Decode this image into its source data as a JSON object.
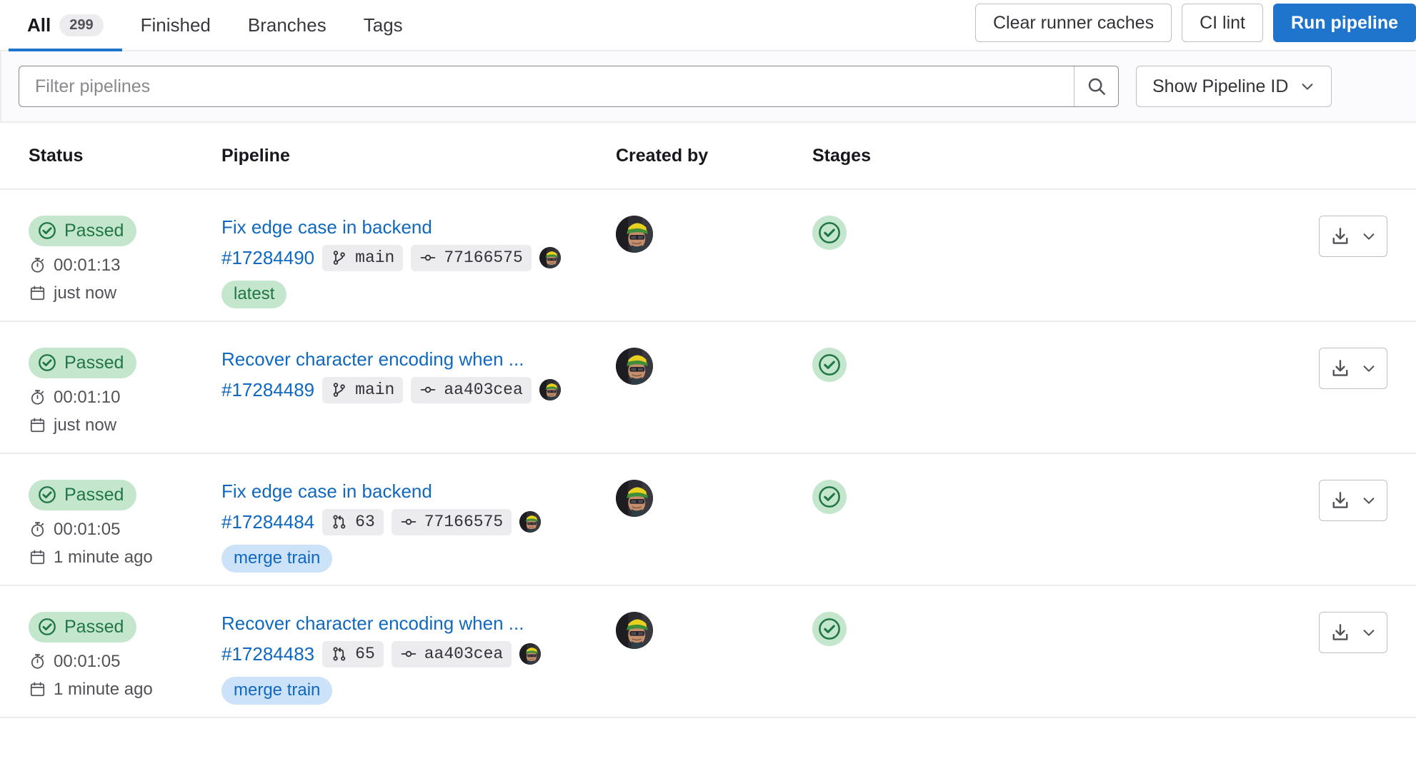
{
  "tabs": [
    {
      "label": "All",
      "count": "299",
      "active": true
    },
    {
      "label": "Finished",
      "count": null,
      "active": false
    },
    {
      "label": "Branches",
      "count": null,
      "active": false
    },
    {
      "label": "Tags",
      "count": null,
      "active": false
    }
  ],
  "top_actions": {
    "clear_caches_label": "Clear runner caches",
    "ci_lint_label": "CI lint",
    "run_pipeline_label": "Run pipeline"
  },
  "filter": {
    "placeholder": "Filter pipelines",
    "value": "",
    "search_icon": "search-icon",
    "show_id_label": "Show Pipeline ID",
    "show_id_chevron": "chevron-down-icon"
  },
  "table": {
    "headers": {
      "status": "Status",
      "pipeline": "Pipeline",
      "created_by": "Created by",
      "stages": "Stages",
      "actions": ""
    },
    "rows": [
      {
        "status_label": "Passed",
        "status_color": "#c3e6cd",
        "status_text_color": "#217645",
        "duration": "00:01:13",
        "finished": "just now",
        "title": "Fix edge case in backend",
        "pipeline_id": "#17284490",
        "ref_icon": "branch-icon",
        "ref": "main",
        "commit_icon": "commit-icon",
        "commit": "77166575",
        "tag": "latest",
        "tag_kind": "latest",
        "stage_status": "passed"
      },
      {
        "status_label": "Passed",
        "status_color": "#c3e6cd",
        "status_text_color": "#217645",
        "duration": "00:01:10",
        "finished": "just now",
        "title": "Recover character encoding when ...",
        "pipeline_id": "#17284489",
        "ref_icon": "branch-icon",
        "ref": "main",
        "commit_icon": "commit-icon",
        "commit": "aa403cea",
        "tag": null,
        "tag_kind": null,
        "stage_status": "passed"
      },
      {
        "status_label": "Passed",
        "status_color": "#c3e6cd",
        "status_text_color": "#217645",
        "duration": "00:01:05",
        "finished": "1 minute ago",
        "title": "Fix edge case in backend",
        "pipeline_id": "#17284484",
        "ref_icon": "merge-request-icon",
        "ref": "63",
        "commit_icon": "commit-icon",
        "commit": "77166575",
        "tag": "merge train",
        "tag_kind": "mergetrain",
        "stage_status": "passed"
      },
      {
        "status_label": "Passed",
        "status_color": "#c3e6cd",
        "status_text_color": "#217645",
        "duration": "00:01:05",
        "finished": "1 minute ago",
        "title": "Recover character encoding when ...",
        "pipeline_id": "#17284483",
        "ref_icon": "merge-request-icon",
        "ref": "65",
        "commit_icon": "commit-icon",
        "commit": "aa403cea",
        "tag": "merge train",
        "tag_kind": "mergetrain",
        "stage_status": "passed"
      }
    ],
    "row_action": {
      "download_icon": "download-icon",
      "chevron_icon": "chevron-down-icon"
    },
    "icons": {
      "duration_icon": "timer-icon",
      "finished_icon": "calendar-icon"
    }
  },
  "colors": {
    "accent": "#1f75cb",
    "link": "#1068bf",
    "success": "#217645",
    "success_bg": "#c3e6cd",
    "info_bg": "#cbe2f9",
    "border": "#ececef",
    "muted_text": "#535158"
  }
}
